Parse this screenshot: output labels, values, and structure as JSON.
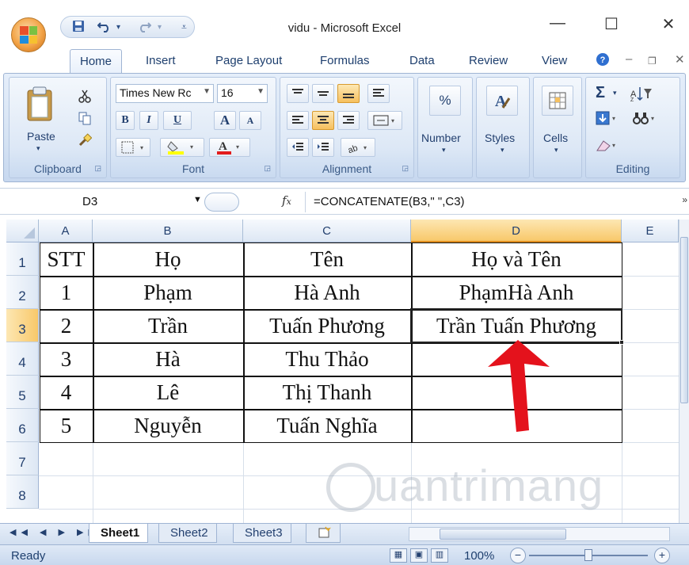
{
  "window": {
    "title": "vidu - Microsoft Excel",
    "min_icon": "—",
    "max_icon": "☐",
    "close_icon": "✕"
  },
  "qat": {
    "save_icon": "💾",
    "undo_icon": "↶",
    "redo_icon": "↷",
    "customize_icon": "▾"
  },
  "tabs": [
    "Home",
    "Insert",
    "Page Layout",
    "Formulas",
    "Data",
    "Review",
    "View"
  ],
  "ribbon": {
    "clipboard": {
      "label": "Clipboard",
      "paste": "Paste"
    },
    "font": {
      "label": "Font",
      "font_name": "Times New Rc",
      "font_size": "16",
      "bold": "B",
      "italic": "I",
      "underline": "U",
      "grow": "A",
      "shrink": "A"
    },
    "alignment": {
      "label": "Alignment"
    },
    "number": {
      "label": "Number",
      "percent": "%"
    },
    "styles": {
      "label": "Styles"
    },
    "cells": {
      "label": "Cells"
    },
    "editing": {
      "label": "Editing",
      "sum": "Σ"
    }
  },
  "formula_bar": {
    "name_box": "D3",
    "fx": "fx",
    "formula": "=CONCATENATE(B3,\" \",C3)"
  },
  "grid": {
    "columns": [
      "A",
      "B",
      "C",
      "D",
      "E"
    ],
    "selected_column": "D",
    "rows": [
      "1",
      "2",
      "3",
      "4",
      "5",
      "6",
      "7",
      "8"
    ],
    "selected_row": "3",
    "cells": [
      [
        "STT",
        "Họ",
        "Tên",
        "Họ và Tên"
      ],
      [
        "1",
        "Phạm",
        "Hà Anh",
        "PhạmHà Anh"
      ],
      [
        "2",
        "Trần",
        "Tuấn Phương",
        "Trần Tuấn Phương"
      ],
      [
        "3",
        "Hà",
        "Thu Thảo",
        ""
      ],
      [
        "4",
        "Lê",
        "Thị Thanh",
        ""
      ],
      [
        "5",
        "Nguyễn",
        "Tuấn Nghĩa",
        ""
      ]
    ],
    "active_cell": "D3"
  },
  "watermark": "uantrimang",
  "sheets": [
    "Sheet1",
    "Sheet2",
    "Sheet3"
  ],
  "active_sheet": "Sheet1",
  "status": {
    "ready": "Ready",
    "zoom": "100%",
    "zoom_out": "−",
    "zoom_in": "+"
  },
  "colors": {
    "arrow": "#e4121c",
    "selected_header": "#f8c86a"
  }
}
